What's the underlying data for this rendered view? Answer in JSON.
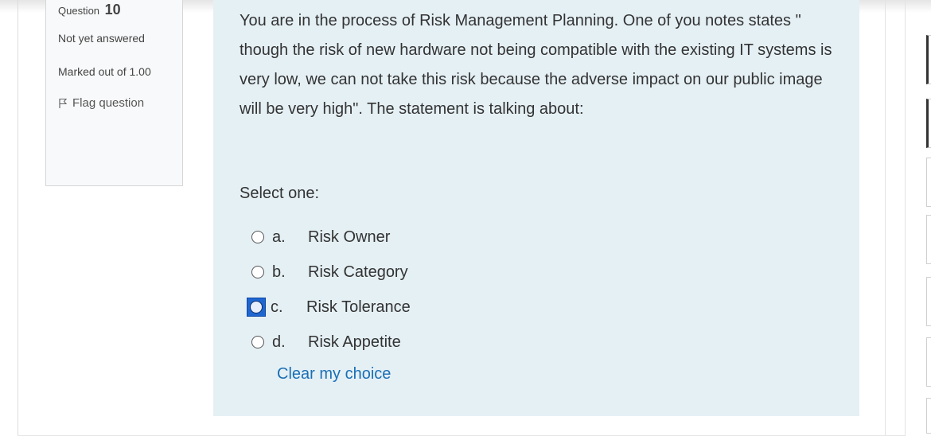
{
  "question_info": {
    "label": "Question",
    "number": "10",
    "state": "Not yet answered",
    "grade": "Marked out of 1.00",
    "flag_label": "Flag question"
  },
  "question": {
    "text": "You are in the process of Risk Management Planning. One of you notes states \" though the risk of new hardware not being compatible with the existing IT systems is very low, we can not take this risk because the adverse impact on our public image will be very high\". The statement is talking about:",
    "prompt": "Select one:",
    "options": [
      {
        "letter": "a.",
        "label": "Risk Owner",
        "selected": false
      },
      {
        "letter": "b.",
        "label": "Risk Category",
        "selected": false
      },
      {
        "letter": "c.",
        "label": "Risk Tolerance",
        "selected": true
      },
      {
        "letter": "d.",
        "label": "Risk Appetite",
        "selected": false
      }
    ],
    "clear_label": "Clear my choice"
  },
  "colors": {
    "formulation_bg": "#e5f0f5",
    "link": "#1a6fb4",
    "selected_highlight": "#1f66d1"
  }
}
